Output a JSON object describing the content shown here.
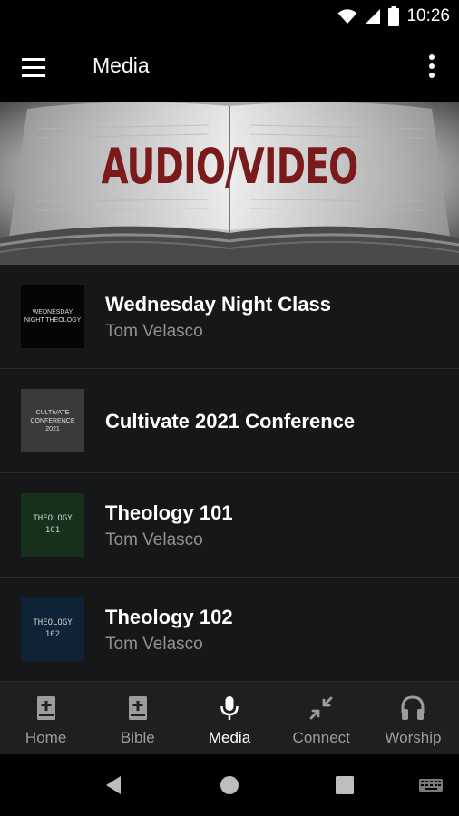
{
  "status": {
    "time": "10:26"
  },
  "app_bar": {
    "title": "Media"
  },
  "hero": {
    "title": "AUDIO/VIDEO"
  },
  "items": [
    {
      "title": "Wednesday Night Class",
      "subtitle": "Tom Velasco",
      "thumb_text": "WEDNESDAY NIGHT THEOLOGY",
      "thumb_bg": "#050505"
    },
    {
      "title": "Cultivate 2021 Conference",
      "subtitle": "",
      "thumb_text": "CULTIVATE CONFERENCE 2021",
      "thumb_bg": "#3a3a3a"
    },
    {
      "title": "Theology 101",
      "subtitle": "Tom Velasco",
      "thumb_text": "THEOLOGY 101",
      "thumb_bg": "#17301c"
    },
    {
      "title": "Theology 102",
      "subtitle": "Tom Velasco",
      "thumb_text": "THEOLOGY 102",
      "thumb_bg": "#0f2236"
    }
  ],
  "nav": [
    {
      "label": "Home",
      "icon": "book-plus-icon",
      "active": false
    },
    {
      "label": "Bible",
      "icon": "bible-icon",
      "active": false
    },
    {
      "label": "Media",
      "icon": "microphone-icon",
      "active": true
    },
    {
      "label": "Connect",
      "icon": "connect-arrows-icon",
      "active": false
    },
    {
      "label": "Worship",
      "icon": "headphones-icon",
      "active": false
    }
  ],
  "colors": {
    "background": "#161718",
    "bottom_nav": "#1d1f20",
    "hero_title": "#7a1a1a",
    "subtitle": "#8f9193"
  }
}
